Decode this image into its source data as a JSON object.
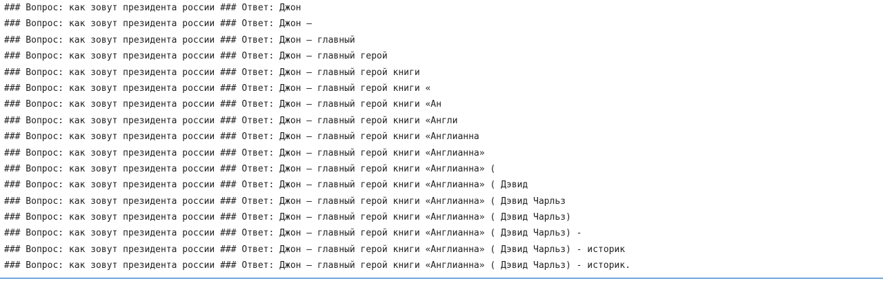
{
  "output": {
    "lines": [
      "### Вопрос: как зовут президента россии ### Ответ: Джон",
      "### Вопрос: как зовут президента россии ### Ответ: Джон —",
      "### Вопрос: как зовут президента россии ### Ответ: Джон — главный",
      "### Вопрос: как зовут президента россии ### Ответ: Джон — главный герой",
      "### Вопрос: как зовут президента россии ### Ответ: Джон — главный герой книги",
      "### Вопрос: как зовут президента россии ### Ответ: Джон — главный герой книги «",
      "### Вопрос: как зовут президента россии ### Ответ: Джон — главный герой книги «Ан",
      "### Вопрос: как зовут президента россии ### Ответ: Джон — главный герой книги «Англи",
      "### Вопрос: как зовут президента россии ### Ответ: Джон — главный герой книги «Англианна",
      "### Вопрос: как зовут президента россии ### Ответ: Джон — главный герой книги «Англианна»",
      "### Вопрос: как зовут президента россии ### Ответ: Джон — главный герой книги «Англианна» (",
      "### Вопрос: как зовут президента россии ### Ответ: Джон — главный герой книги «Англианна» ( Дэвид",
      "### Вопрос: как зовут президента россии ### Ответ: Джон — главный герой книги «Англианна» ( Дэвид Чарльз",
      "### Вопрос: как зовут президента россии ### Ответ: Джон — главный герой книги «Англианна» ( Дэвид Чарльз)",
      "### Вопрос: как зовут президента россии ### Ответ: Джон — главный герой книги «Англианна» ( Дэвид Чарльз) -",
      "### Вопрос: как зовут президента россии ### Ответ: Джон — главный герой книги «Англианна» ( Дэвид Чарльз) - историк",
      "### Вопрос: как зовут президента россии ### Ответ: Джон — главный герой книги «Англианна» ( Дэвид Чарльз) - историк."
    ]
  },
  "colors": {
    "text": "#1f1f1f",
    "background": "#ffffff",
    "divider": "#6fa8dc"
  }
}
